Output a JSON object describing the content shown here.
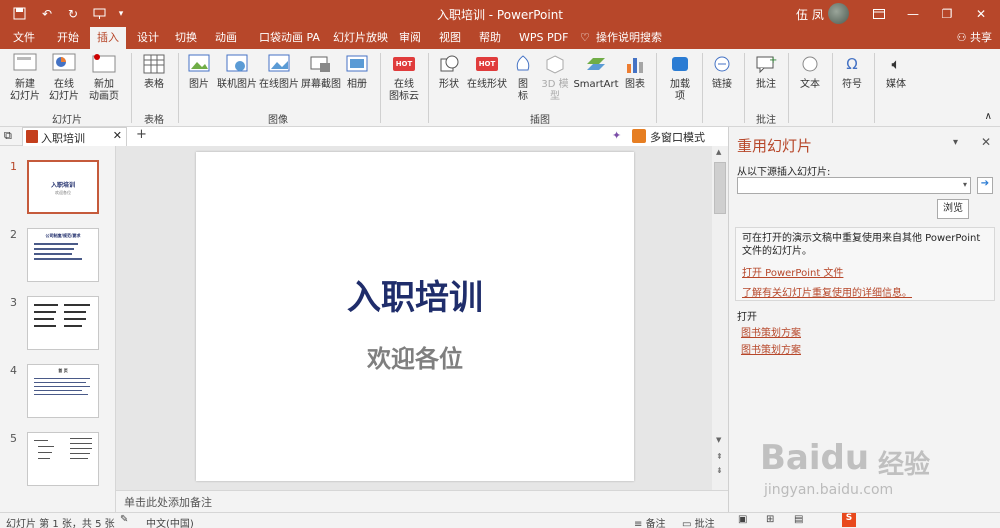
{
  "window": {
    "title": "入职培训 - PowerPoint",
    "user_name": "伍 凤"
  },
  "ribbon_tabs": [
    "文件",
    "开始",
    "插入",
    "设计",
    "切换",
    "动画",
    "口袋动画 PA",
    "幻灯片放映",
    "审阅",
    "视图",
    "帮助",
    "WPS PDF",
    "操作说明搜索"
  ],
  "active_tab": "插入",
  "share_label": "共享",
  "ribbon": {
    "new_slide": "新建\n幻灯片",
    "online_slide": "在线\n幻灯片",
    "new_page": "新加\n动画页",
    "table": "表格",
    "picture": "图片",
    "online_picture": "联机图片",
    "online_picture2": "在线图片",
    "screenshot": "屏幕截图",
    "album": "相册",
    "online_icon": "在线\n图标云",
    "shapes": "形状",
    "online_shapes": "在线形状",
    "icons": "图\n标",
    "model3d": "3D 模\n型",
    "smartart": "SmartArt",
    "chart": "图表",
    "addins": "加载\n项",
    "links": "链接",
    "comment": "批注",
    "text": "文本",
    "symbols": "符号",
    "media": "媒体",
    "groups": {
      "slides": "幻灯片",
      "tables": "表格",
      "images": "图像",
      "illustrations": "插图",
      "comments": "批注"
    },
    "hot_badge": "HOT"
  },
  "doc_tab": "入职培训",
  "multi_window_label": "多窗口模式",
  "slides": [
    {
      "num": "1",
      "title": "入职培训",
      "subtitle": "欢迎各位"
    },
    {
      "num": "2",
      "title": "公司制度/规范/要求"
    },
    {
      "num": "3",
      "title": ""
    },
    {
      "num": "4",
      "title": "首 页"
    },
    {
      "num": "5",
      "title": ""
    }
  ],
  "current_slide": {
    "title": "入职培训",
    "subtitle": "欢迎各位"
  },
  "notes_placeholder": "单击此处添加备注",
  "reuse_pane": {
    "title": "重用幻灯片",
    "insert_from_label": "从以下源插入幻灯片:",
    "browse_button": "浏览",
    "info_text": "可在打开的演示文稿中重复使用来自其他 PowerPoint 文件的幻灯片。",
    "open_link": "打开 PowerPoint 文件",
    "learn_link": "了解有关幻灯片重复使用的详细信息。",
    "open_section": "打开",
    "recent_files": [
      "图书策划方案",
      "图书策划方案"
    ]
  },
  "status": {
    "slide_info": "幻灯片 第 1 张，共 5 张",
    "language": "中文(中国)",
    "notes_btn": "备注",
    "comments_btn": "批注"
  },
  "watermark": {
    "brand": "Baidu",
    "cn": "经验",
    "url": "jingyan.baidu.com"
  },
  "colors": {
    "accent": "#b7472a",
    "title_blue": "#1f2d6b",
    "subtitle_gray": "#7f7f7f"
  }
}
